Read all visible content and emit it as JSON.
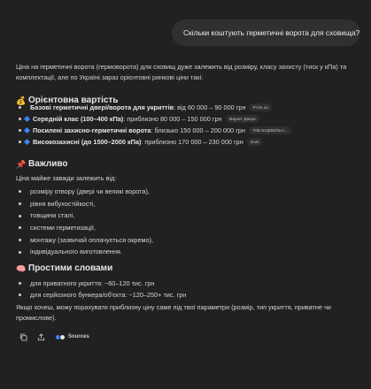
{
  "chat": {
    "user_message": "Скільки коштують герметичні ворота для сховища?"
  },
  "answer": {
    "intro": "Ціна на герметичні ворота (гермоворота) для сховищ дуже залежить від розміру, класу захисту (тиск у кПа) та комплектації, але по Україні зараз орієнтовні ринкові ціни такі:",
    "section1": {
      "emoji": "💰",
      "title": "Орієнтовна вартість",
      "items": [
        {
          "bold": "Базові герметичні двері/ворота для укриттів",
          "text": ": від 60 000 – 90 000 грн",
          "source": "Prom.ua",
          "bullet": "dot"
        },
        {
          "bold": "Середній клас (100–400 кПа)",
          "text": ": приблизно 80 000 – 150 000 грн",
          "source": "Маркет Двери",
          "bullet": "diamond"
        },
        {
          "bold": "Посилені захисно-герметичні ворота",
          "text": ": близько 150 000 – 200 000 грн",
          "source": "ТОВ БУДІВЕЛЬН...",
          "bullet": "diamond"
        },
        {
          "bold": "Високозахисні (до 1500–2000 кПа)",
          "text": ": приблизно 170 000 – 230 000 грн",
          "source": "Dust",
          "bullet": "diamond"
        }
      ]
    },
    "section2": {
      "emoji": "📌",
      "title": "Важливо",
      "lead": "Ціна майже завжди залежить від:",
      "items": [
        "розміру отвору (двері чи великі ворота),",
        "рівня вибухостійкості,",
        "товщини сталі,",
        "системи герметизації,",
        "монтажу (зазвичай оплачується окремо),",
        "індивідуального виготовлення."
      ]
    },
    "section3": {
      "emoji": "🧠",
      "title": "Простими словами",
      "items": [
        "для приватного укриття: ~60–120 тис. грн",
        "для серйозного бункера/об'єкта: ~120–250+ тис. грн"
      ]
    },
    "outro": "Якщо хочеш, можу порахувати приблизну ціну саме під твої параметри (розмір, тип укриття, приватне чи промислове)."
  },
  "actions": {
    "copy_icon": "copy-icon",
    "share_icon": "share-icon",
    "sources_label": "Sources",
    "source_colors": [
      "#3b82f6",
      "#e5e5e5"
    ]
  }
}
